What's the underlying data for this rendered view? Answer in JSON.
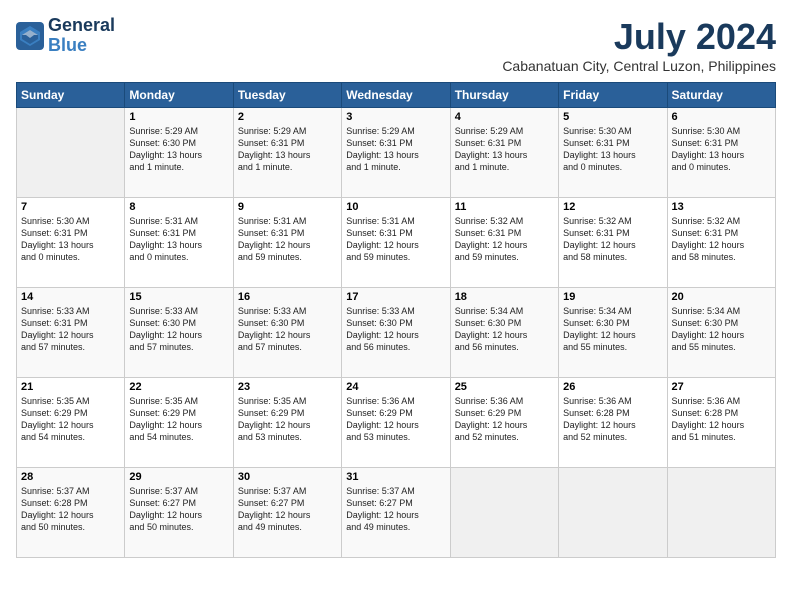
{
  "logo": {
    "line1": "General",
    "line2": "Blue"
  },
  "title": "July 2024",
  "location": "Cabanatuan City, Central Luzon, Philippines",
  "days_of_week": [
    "Sunday",
    "Monday",
    "Tuesday",
    "Wednesday",
    "Thursday",
    "Friday",
    "Saturday"
  ],
  "weeks": [
    [
      {
        "day": "",
        "info": ""
      },
      {
        "day": "1",
        "info": "Sunrise: 5:29 AM\nSunset: 6:30 PM\nDaylight: 13 hours\nand 1 minute."
      },
      {
        "day": "2",
        "info": "Sunrise: 5:29 AM\nSunset: 6:31 PM\nDaylight: 13 hours\nand 1 minute."
      },
      {
        "day": "3",
        "info": "Sunrise: 5:29 AM\nSunset: 6:31 PM\nDaylight: 13 hours\nand 1 minute."
      },
      {
        "day": "4",
        "info": "Sunrise: 5:29 AM\nSunset: 6:31 PM\nDaylight: 13 hours\nand 1 minute."
      },
      {
        "day": "5",
        "info": "Sunrise: 5:30 AM\nSunset: 6:31 PM\nDaylight: 13 hours\nand 0 minutes."
      },
      {
        "day": "6",
        "info": "Sunrise: 5:30 AM\nSunset: 6:31 PM\nDaylight: 13 hours\nand 0 minutes."
      }
    ],
    [
      {
        "day": "7",
        "info": "Sunrise: 5:30 AM\nSunset: 6:31 PM\nDaylight: 13 hours\nand 0 minutes."
      },
      {
        "day": "8",
        "info": "Sunrise: 5:31 AM\nSunset: 6:31 PM\nDaylight: 13 hours\nand 0 minutes."
      },
      {
        "day": "9",
        "info": "Sunrise: 5:31 AM\nSunset: 6:31 PM\nDaylight: 12 hours\nand 59 minutes."
      },
      {
        "day": "10",
        "info": "Sunrise: 5:31 AM\nSunset: 6:31 PM\nDaylight: 12 hours\nand 59 minutes."
      },
      {
        "day": "11",
        "info": "Sunrise: 5:32 AM\nSunset: 6:31 PM\nDaylight: 12 hours\nand 59 minutes."
      },
      {
        "day": "12",
        "info": "Sunrise: 5:32 AM\nSunset: 6:31 PM\nDaylight: 12 hours\nand 58 minutes."
      },
      {
        "day": "13",
        "info": "Sunrise: 5:32 AM\nSunset: 6:31 PM\nDaylight: 12 hours\nand 58 minutes."
      }
    ],
    [
      {
        "day": "14",
        "info": "Sunrise: 5:33 AM\nSunset: 6:31 PM\nDaylight: 12 hours\nand 57 minutes."
      },
      {
        "day": "15",
        "info": "Sunrise: 5:33 AM\nSunset: 6:30 PM\nDaylight: 12 hours\nand 57 minutes."
      },
      {
        "day": "16",
        "info": "Sunrise: 5:33 AM\nSunset: 6:30 PM\nDaylight: 12 hours\nand 57 minutes."
      },
      {
        "day": "17",
        "info": "Sunrise: 5:33 AM\nSunset: 6:30 PM\nDaylight: 12 hours\nand 56 minutes."
      },
      {
        "day": "18",
        "info": "Sunrise: 5:34 AM\nSunset: 6:30 PM\nDaylight: 12 hours\nand 56 minutes."
      },
      {
        "day": "19",
        "info": "Sunrise: 5:34 AM\nSunset: 6:30 PM\nDaylight: 12 hours\nand 55 minutes."
      },
      {
        "day": "20",
        "info": "Sunrise: 5:34 AM\nSunset: 6:30 PM\nDaylight: 12 hours\nand 55 minutes."
      }
    ],
    [
      {
        "day": "21",
        "info": "Sunrise: 5:35 AM\nSunset: 6:29 PM\nDaylight: 12 hours\nand 54 minutes."
      },
      {
        "day": "22",
        "info": "Sunrise: 5:35 AM\nSunset: 6:29 PM\nDaylight: 12 hours\nand 54 minutes."
      },
      {
        "day": "23",
        "info": "Sunrise: 5:35 AM\nSunset: 6:29 PM\nDaylight: 12 hours\nand 53 minutes."
      },
      {
        "day": "24",
        "info": "Sunrise: 5:36 AM\nSunset: 6:29 PM\nDaylight: 12 hours\nand 53 minutes."
      },
      {
        "day": "25",
        "info": "Sunrise: 5:36 AM\nSunset: 6:29 PM\nDaylight: 12 hours\nand 52 minutes."
      },
      {
        "day": "26",
        "info": "Sunrise: 5:36 AM\nSunset: 6:28 PM\nDaylight: 12 hours\nand 52 minutes."
      },
      {
        "day": "27",
        "info": "Sunrise: 5:36 AM\nSunset: 6:28 PM\nDaylight: 12 hours\nand 51 minutes."
      }
    ],
    [
      {
        "day": "28",
        "info": "Sunrise: 5:37 AM\nSunset: 6:28 PM\nDaylight: 12 hours\nand 50 minutes."
      },
      {
        "day": "29",
        "info": "Sunrise: 5:37 AM\nSunset: 6:27 PM\nDaylight: 12 hours\nand 50 minutes."
      },
      {
        "day": "30",
        "info": "Sunrise: 5:37 AM\nSunset: 6:27 PM\nDaylight: 12 hours\nand 49 minutes."
      },
      {
        "day": "31",
        "info": "Sunrise: 5:37 AM\nSunset: 6:27 PM\nDaylight: 12 hours\nand 49 minutes."
      },
      {
        "day": "",
        "info": ""
      },
      {
        "day": "",
        "info": ""
      },
      {
        "day": "",
        "info": ""
      }
    ]
  ]
}
